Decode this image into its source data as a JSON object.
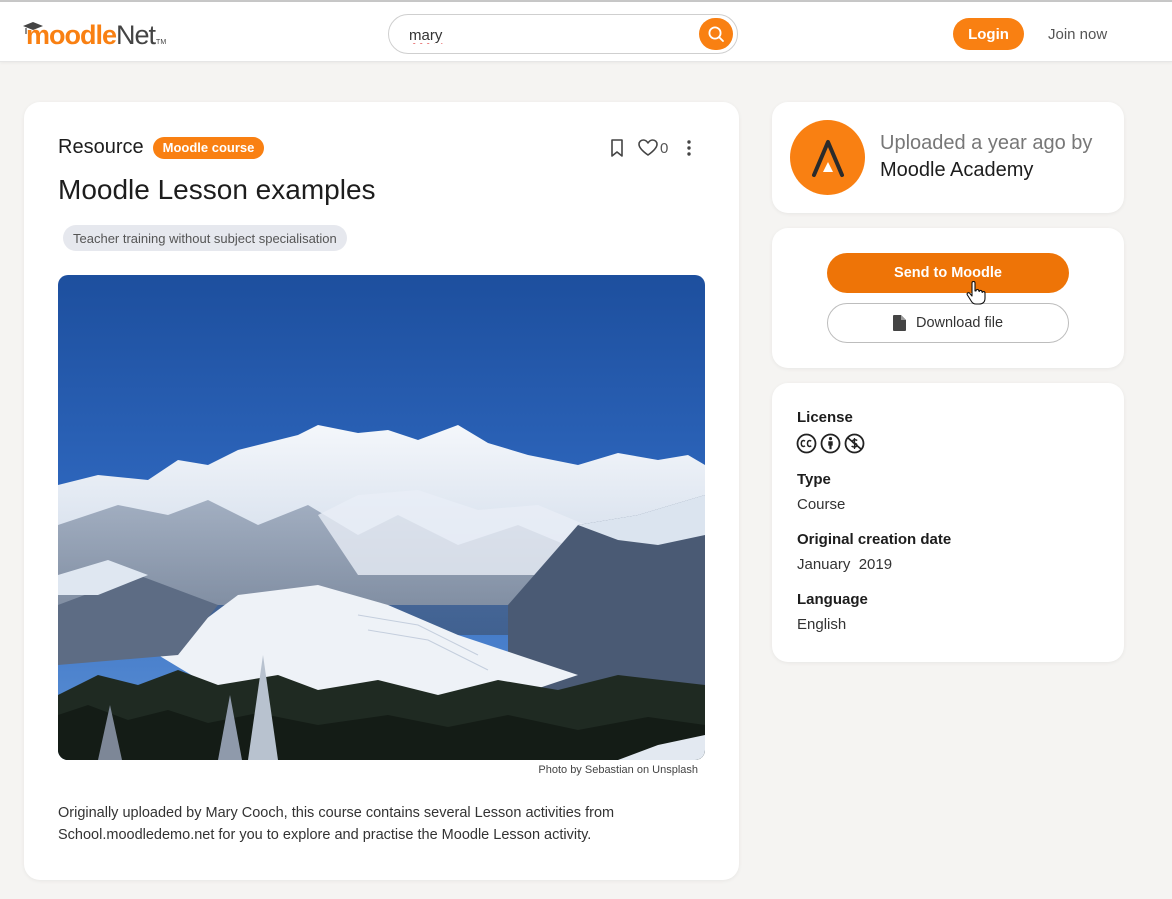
{
  "header": {
    "logo_primary": "moodle",
    "logo_secondary": "Net",
    "logo_tm": "TM",
    "search_value": "mary",
    "login_label": "Login",
    "join_label": "Join now"
  },
  "resource": {
    "type_label": "Resource",
    "badge": "Moodle course",
    "like_count": "0",
    "title": "Moodle Lesson examples",
    "subject_tag": "Teacher training without subject specialisation",
    "photo_credit": "Photo by Sebastian on Unsplash",
    "description": "Originally uploaded by Mary Cooch, this course contains several Lesson activities from School.moodledemo.net for you to explore and practise the Moodle Lesson activity."
  },
  "author": {
    "uploaded_text": "Uploaded a year ago by",
    "name": "Moodle Academy"
  },
  "actions": {
    "send_label": "Send to Moodle",
    "download_label": "Download file"
  },
  "meta": {
    "license_label": "License",
    "license_icons": [
      "cc-icon",
      "by-attribution-icon",
      "non-commercial-icon"
    ],
    "type_label": "Type",
    "type_value": "Course",
    "date_label": "Original creation date",
    "date_value": "January  2019",
    "language_label": "Language",
    "language_value": "English"
  },
  "colors": {
    "accent": "#f98012",
    "accent_dark": "#ee7407",
    "background": "#f5f4f2"
  }
}
